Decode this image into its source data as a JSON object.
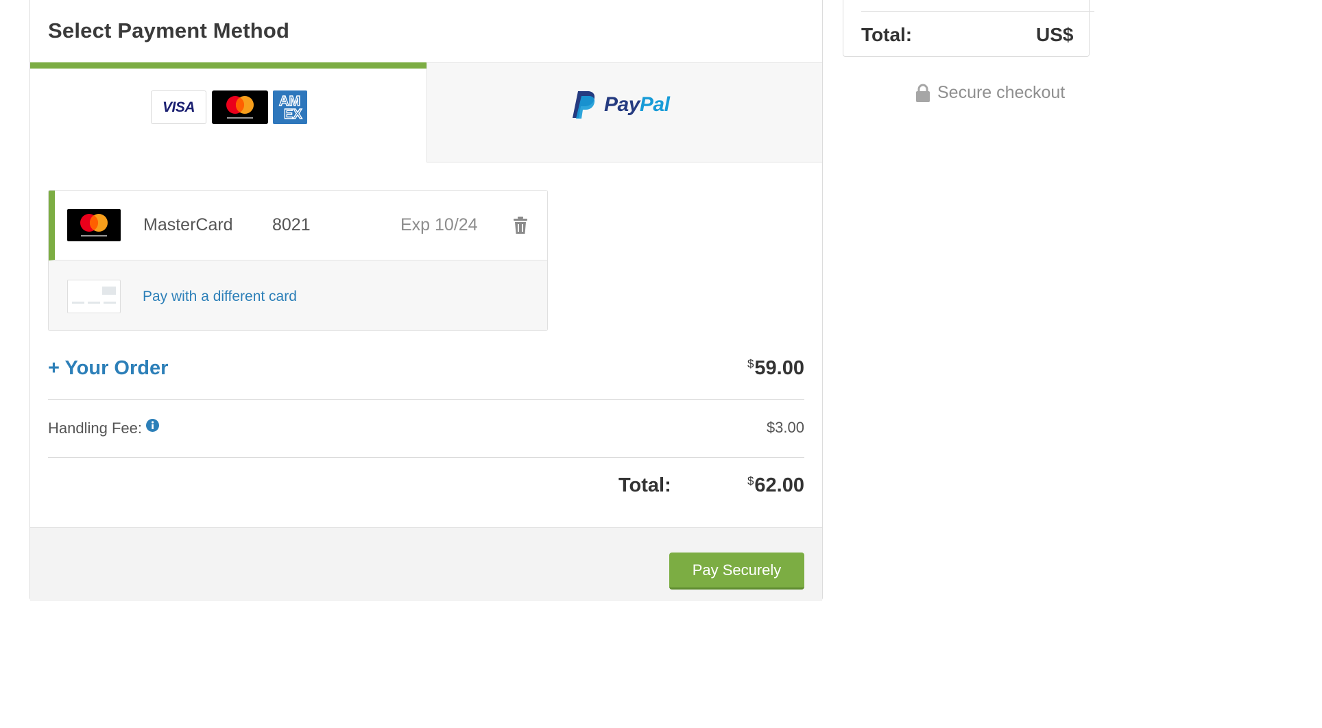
{
  "payment_panel": {
    "title": "Select Payment Method",
    "tabs": [
      {
        "id": "cards",
        "logos": [
          "visa-icon",
          "mastercard-icon",
          "amex-icon"
        ],
        "visa_text": "VISA",
        "amex_text": [
          "AM",
          "EX"
        ],
        "active": true
      },
      {
        "id": "paypal",
        "logos": [
          "paypal-icon"
        ],
        "text_pay": "Pay",
        "text_pal": "Pal",
        "active": false
      }
    ],
    "saved_card": {
      "brand": "MasterCard",
      "last4": "8021",
      "expiry": "Exp 10/24",
      "selected": true,
      "actions": [
        "trash-icon"
      ]
    },
    "new_card_label": "Pay with a different card"
  },
  "order": {
    "toggle_label": "+ Your Order",
    "subtotal_currency": "$",
    "subtotal_amount": "59.00",
    "handling_fee_label": "Handling Fee:",
    "handling_fee_value": "$3.00",
    "total_label": "Total:",
    "total_currency": "$",
    "total_amount": "62.00"
  },
  "footer": {
    "pay_button_label": "Pay Securely"
  },
  "sidebar": {
    "total_label": "Total:",
    "total_value": "US$",
    "secure_label": "Secure checkout"
  },
  "colors": {
    "accent_green": "#7cad43",
    "link_blue": "#2c7fb8",
    "paypal_dark": "#253b80",
    "paypal_light": "#179bd7",
    "amex_blue": "#2e77bc"
  }
}
